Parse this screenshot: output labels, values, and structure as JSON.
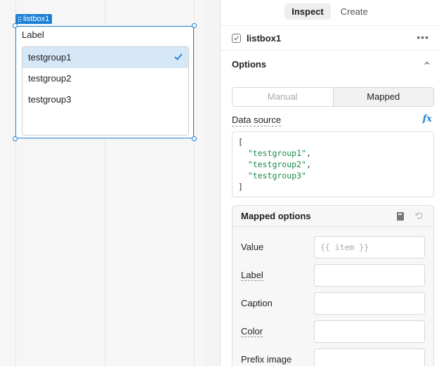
{
  "canvas": {
    "selection_badge": "listbox1",
    "widget": {
      "label": "Label",
      "items": [
        {
          "label": "testgroup1",
          "selected": true
        },
        {
          "label": "testgroup2",
          "selected": false
        },
        {
          "label": "testgroup3",
          "selected": false
        }
      ]
    }
  },
  "panel": {
    "tabs": [
      {
        "label": "Inspect",
        "active": true
      },
      {
        "label": "Create",
        "active": false
      }
    ],
    "component_name": "listbox1",
    "options_section": {
      "title": "Options",
      "mode_buttons": [
        {
          "label": "Manual",
          "active": false
        },
        {
          "label": "Mapped",
          "active": true
        }
      ],
      "data_source_label": "Data source",
      "fx_label": "fx",
      "code_lines": {
        "open": "[",
        "item1": "\"testgroup1\"",
        "item2": "\"testgroup2\"",
        "item3": "\"testgroup3\"",
        "close": "]"
      },
      "mapped_options": {
        "title": "Mapped options",
        "fields": {
          "value": {
            "label": "Value",
            "placeholder": "{{ item }}"
          },
          "label": {
            "label": "Label",
            "placeholder": ""
          },
          "caption": {
            "label": "Caption",
            "placeholder": ""
          },
          "color": {
            "label": "Color",
            "placeholder": ""
          },
          "prefix_image": {
            "label": "Prefix image",
            "placeholder": ""
          }
        }
      }
    }
  },
  "colors": {
    "accent": "#1a7fd6",
    "selected_row": "#d6e8f8",
    "code_string": "#178a4a"
  }
}
